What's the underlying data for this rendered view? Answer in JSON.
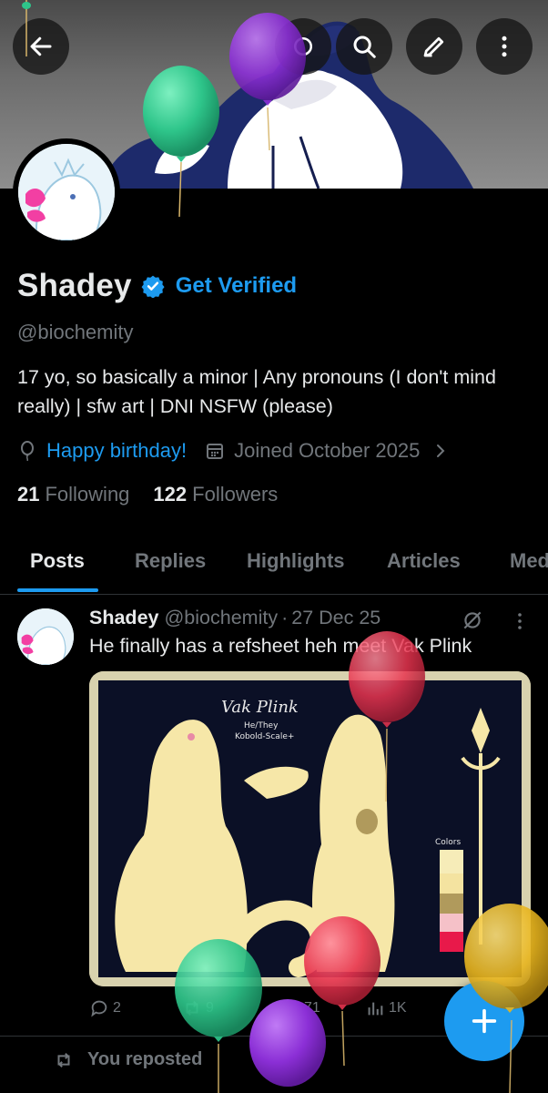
{
  "header": {
    "back_icon": "arrow-left-icon",
    "search_icon": "search-icon",
    "edit_icon": "pencil-icon",
    "more_icon": "more-vertical-icon"
  },
  "profile": {
    "name": "Shadey",
    "verified_icon": "verified-badge-icon",
    "get_verified_label": "Get Verified",
    "handle": "@biochemity",
    "bio": "17 yo, so basically a minor | Any pronouns (I don't mind really) | sfw art | DNI NSFW (please)",
    "birthday_icon": "balloon-icon",
    "birthday_text": "Happy birthday!",
    "joined_icon": "calendar-icon",
    "joined_text": "Joined October 2025",
    "following_count": "21",
    "following_label": "Following",
    "followers_count": "122",
    "followers_label": "Followers"
  },
  "tabs": [
    {
      "label": "Posts",
      "active": true
    },
    {
      "label": "Replies"
    },
    {
      "label": "Highlights"
    },
    {
      "label": "Articles"
    },
    {
      "label": "Med"
    }
  ],
  "post": {
    "author_name": "Shadey",
    "author_handle": "@biochemity",
    "separator": "·",
    "date": "27 Dec 25",
    "text": "He finally has a refsheet heh meet Vak Plink",
    "image_labels": {
      "title": "Vak Plink",
      "pronouns": "He/They",
      "species": "Kobold-Scale+",
      "colors_label": "Colors"
    },
    "actions": {
      "reply_count": "2",
      "repost_count": "9",
      "like_count": "71",
      "views_count": "1K"
    }
  },
  "repost_row": {
    "label": "You reposted"
  },
  "fab_icon": "plus-icon",
  "colors": {
    "accent": "#1d9bf0",
    "background": "#000000",
    "text_primary": "#e7e9ea",
    "text_secondary": "#71767b",
    "balloon_green": "#2ec58a",
    "balloon_purple": "#8b2fd6",
    "balloon_red": "#e8344f",
    "balloon_yellow": "#e8b51e"
  }
}
